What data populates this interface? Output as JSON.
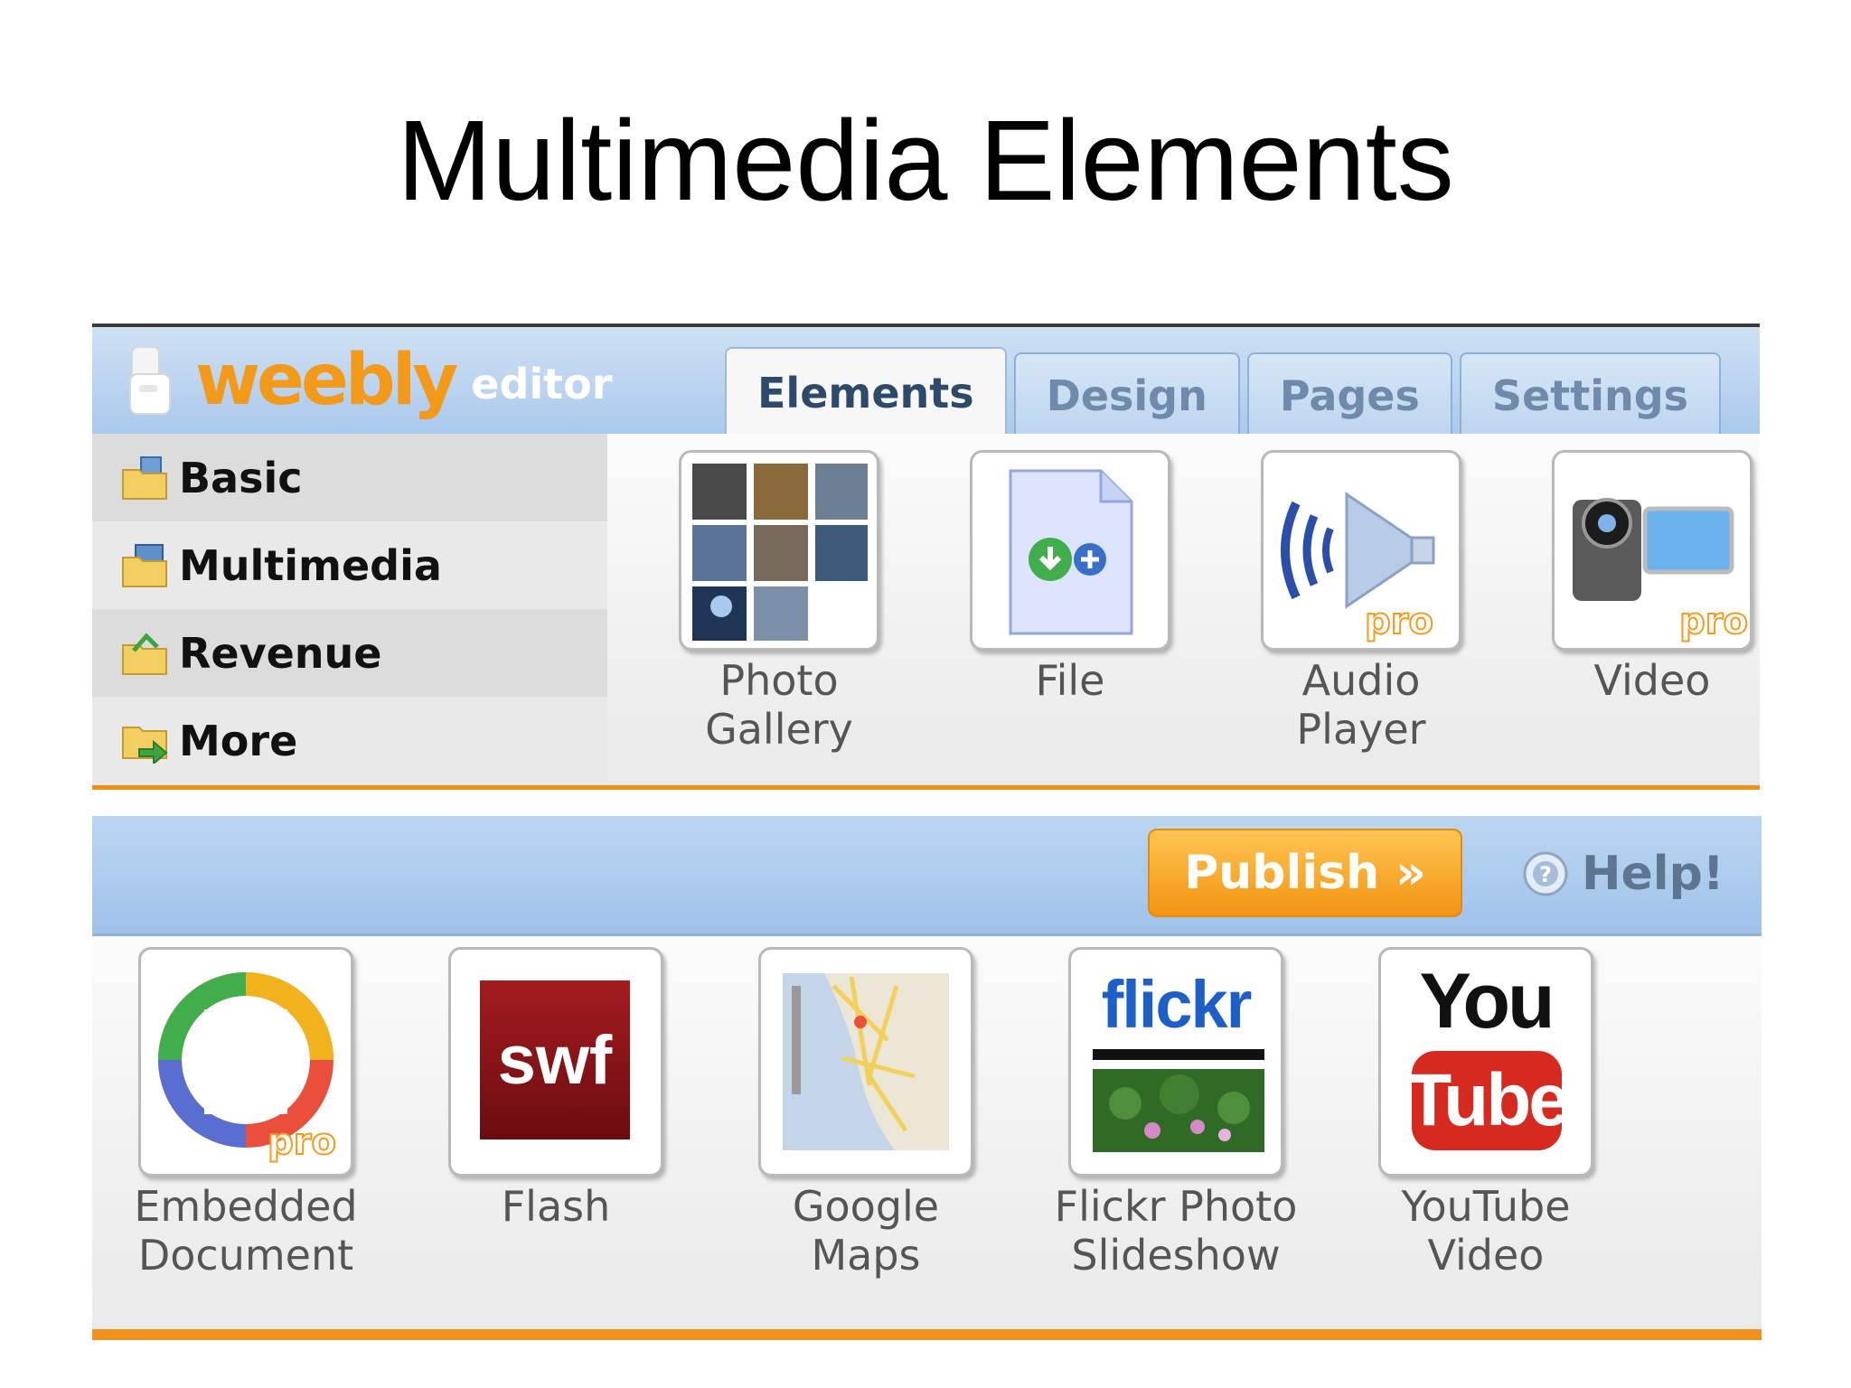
{
  "slide": {
    "title": "Multimedia Elements"
  },
  "editor": {
    "logo_word": "weebly",
    "logo_sub": "editor",
    "tabs": [
      {
        "label": "Elements",
        "active": true
      },
      {
        "label": "Design",
        "active": false
      },
      {
        "label": "Pages",
        "active": false
      },
      {
        "label": "Settings",
        "active": false
      }
    ],
    "sidebar": [
      {
        "label": "Basic",
        "icon": "folder-icon"
      },
      {
        "label": "Multimedia",
        "icon": "folder-icon"
      },
      {
        "label": "Revenue",
        "icon": "folder-money-icon"
      },
      {
        "label": "More",
        "icon": "folder-arrow-icon"
      }
    ],
    "elements": [
      {
        "label_line1": "Photo",
        "label_line2": "Gallery",
        "icon": "photo-gallery-icon"
      },
      {
        "label_line1": "File",
        "label_line2": "",
        "icon": "file-icon"
      },
      {
        "label_line1": "Audio",
        "label_line2": "Player",
        "icon": "audio-player-icon",
        "badge": "pro"
      },
      {
        "label_line1": "Video",
        "label_line2": "",
        "icon": "video-camera-icon",
        "badge": "pro"
      }
    ]
  },
  "toolbar": {
    "publish_label": "Publish »",
    "help_label": "Help!"
  },
  "multimedia": [
    {
      "label_line1": "Embedded",
      "label_line2": "Document",
      "icon": "embedded-document-icon",
      "badge": "pro"
    },
    {
      "label_line1": "Flash",
      "label_line2": "",
      "icon": "flash-swf-icon",
      "icon_text": "swf"
    },
    {
      "label_line1": "Google",
      "label_line2": "Maps",
      "icon": "google-maps-icon"
    },
    {
      "label_line1": "Flickr Photo",
      "label_line2": "Slideshow",
      "icon": "flickr-icon",
      "icon_text": "flickr"
    },
    {
      "label_line1": "YouTube",
      "label_line2": "Video",
      "icon": "youtube-icon",
      "icon_text_top": "You",
      "icon_text_bottom": "Tube"
    }
  ],
  "colors": {
    "accent_orange": "#f08f1a",
    "header_blue": "#aac9ec",
    "logo_orange": "#f39a1b"
  }
}
